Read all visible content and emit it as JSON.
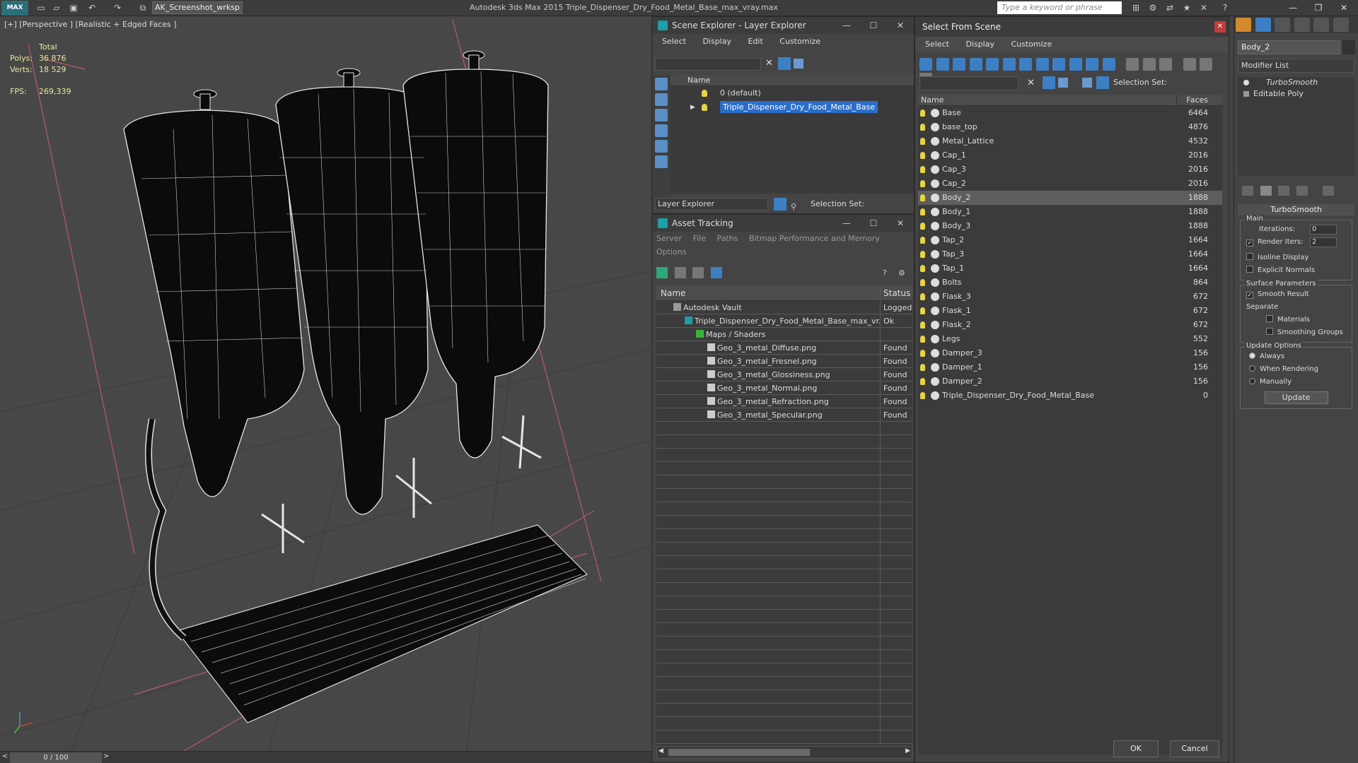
{
  "app": {
    "logo_label": "MAX",
    "workspace": "AK_Screenshot_wrksp",
    "title": "Autodesk 3ds Max  2015    Triple_Dispenser_Dry_Food_Metal_Base_max_vray.max",
    "search_placeholder": "Type a keyword or phrase"
  },
  "viewport": {
    "label": "[+] [Perspective ] [Realistic + Edged Faces ]",
    "stats": {
      "total_label": "Total",
      "polys_label": "Polys:",
      "polys_value": "36 876",
      "verts_label": "Verts:",
      "verts_value": "18 529",
      "fps_label": "FPS:",
      "fps_value": "269,339"
    },
    "timeline": "0 / 100"
  },
  "scene_explorer": {
    "title": "Scene Explorer - Layer Explorer",
    "menu": [
      "Select",
      "Display",
      "Edit",
      "Customize"
    ],
    "column": "Name",
    "rows": [
      {
        "label": "0 (default)",
        "selected": false
      },
      {
        "label": "Triple_Dispenser_Dry_Food_Metal_Base",
        "selected": true
      }
    ],
    "layer_dropdown": "Layer Explorer",
    "selection_set_label": "Selection Set:"
  },
  "asset_tracking": {
    "title": "Asset Tracking",
    "menu_line1": [
      "Server",
      "File",
      "Paths",
      "Bitmap Performance and Memory"
    ],
    "menu_line2": [
      "Options"
    ],
    "col_name": "Name",
    "col_status": "Status",
    "rows": [
      {
        "name": "Autodesk Vault",
        "status": "Logged",
        "indent": 0
      },
      {
        "name": "Triple_Dispenser_Dry_Food_Metal_Base_max_vr...",
        "status": "Ok",
        "indent": 1
      },
      {
        "name": "Maps / Shaders",
        "status": "",
        "indent": 2
      },
      {
        "name": "Geo_3_metal_Diffuse.png",
        "status": "Found",
        "indent": 3
      },
      {
        "name": "Geo_3_metal_Fresnel.png",
        "status": "Found",
        "indent": 3
      },
      {
        "name": "Geo_3_metal_Glossiness.png",
        "status": "Found",
        "indent": 3
      },
      {
        "name": "Geo_3_metal_Normal.png",
        "status": "Found",
        "indent": 3
      },
      {
        "name": "Geo_3_metal_Refraction.png",
        "status": "Found",
        "indent": 3
      },
      {
        "name": "Geo_3_metal_Specular.png",
        "status": "Found",
        "indent": 3
      }
    ]
  },
  "select_from_scene": {
    "title": "Select From Scene",
    "menu": [
      "Select",
      "Display",
      "Customize"
    ],
    "selection_set_label": "Selection Set:",
    "col_name": "Name",
    "col_faces": "Faces",
    "rows": [
      {
        "name": "Base",
        "faces": "6464"
      },
      {
        "name": "base_top",
        "faces": "4876"
      },
      {
        "name": "Metal_Lattice",
        "faces": "4532"
      },
      {
        "name": "Cap_1",
        "faces": "2016"
      },
      {
        "name": "Cap_3",
        "faces": "2016"
      },
      {
        "name": "Cap_2",
        "faces": "2016"
      },
      {
        "name": "Body_2",
        "faces": "1888",
        "selected": true
      },
      {
        "name": "Body_1",
        "faces": "1888"
      },
      {
        "name": "Body_3",
        "faces": "1888"
      },
      {
        "name": "Tap_2",
        "faces": "1664"
      },
      {
        "name": "Tap_3",
        "faces": "1664"
      },
      {
        "name": "Tap_1",
        "faces": "1664"
      },
      {
        "name": "Bolts",
        "faces": "864"
      },
      {
        "name": "Flask_3",
        "faces": "672"
      },
      {
        "name": "Flask_1",
        "faces": "672"
      },
      {
        "name": "Flask_2",
        "faces": "672"
      },
      {
        "name": "Legs",
        "faces": "552"
      },
      {
        "name": "Damper_3",
        "faces": "156"
      },
      {
        "name": "Damper_1",
        "faces": "156"
      },
      {
        "name": "Damper_2",
        "faces": "156"
      },
      {
        "name": "Triple_Dispenser_Dry_Food_Metal_Base",
        "faces": "0"
      }
    ],
    "ok_label": "OK",
    "cancel_label": "Cancel"
  },
  "command_panel": {
    "object_name": "Body_2",
    "modifier_list": "Modifier List",
    "stack": [
      "TurboSmooth",
      "Editable Poly"
    ],
    "rollout_title": "TurboSmooth",
    "main_label": "Main",
    "iterations_label": "Iterations:",
    "iterations_value": "0",
    "render_iters_label": "Render Iters:",
    "render_iters_value": "2",
    "isoline_label": "Isoline Display",
    "explicit_normals_label": "Explicit Normals",
    "surface_params_label": "Surface Parameters",
    "smooth_result_label": "Smooth Result",
    "separate_label": "Separate",
    "materials_label": "Materials",
    "smoothing_groups_label": "Smoothing Groups",
    "update_options_label": "Update Options",
    "always_label": "Always",
    "when_rendering_label": "When Rendering",
    "manually_label": "Manually",
    "update_button": "Update"
  }
}
